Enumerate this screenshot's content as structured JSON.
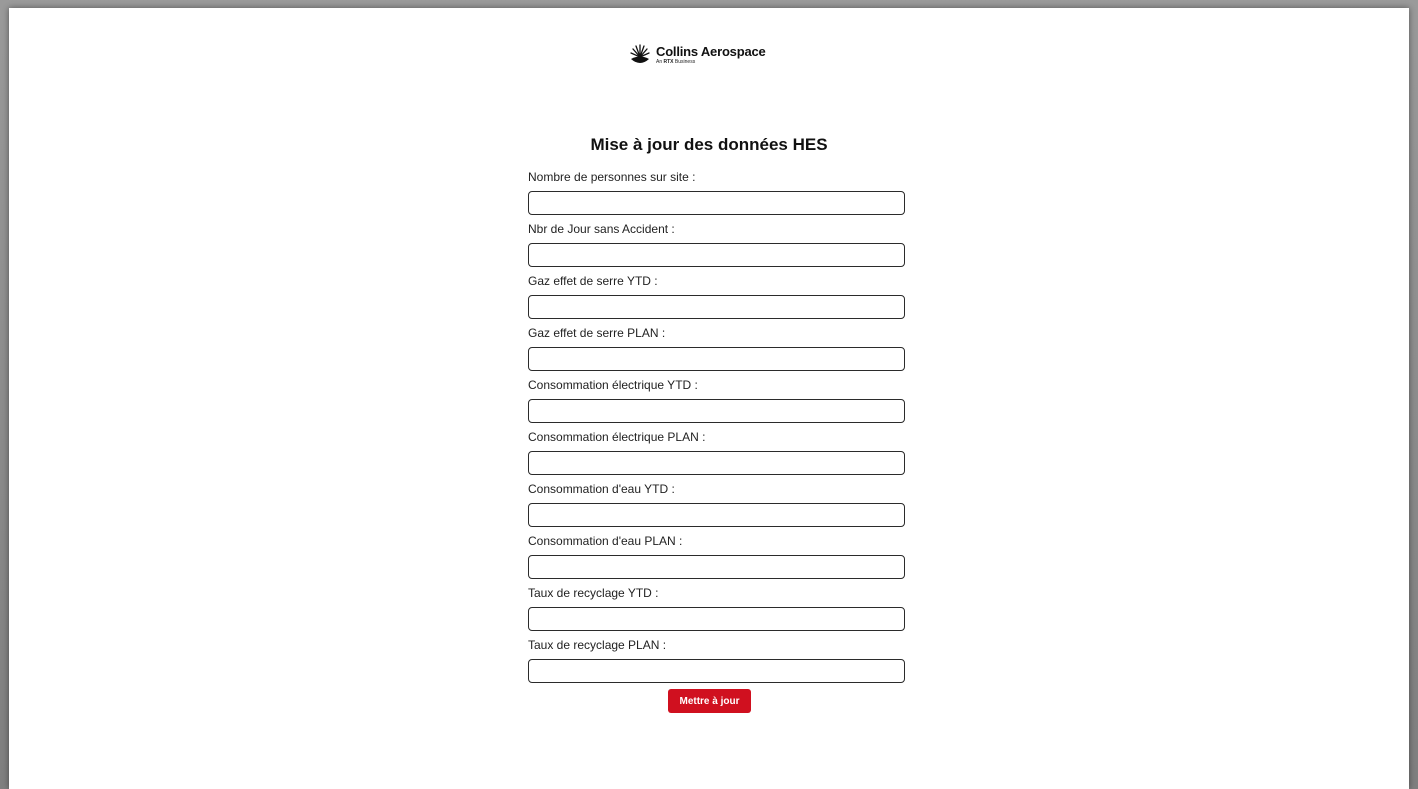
{
  "brand": {
    "name": "Collins Aerospace",
    "tagline_prefix": "An ",
    "tagline_bold": "RTX",
    "tagline_suffix": " Business",
    "accent_color": "#d0101f",
    "logo_icon": "sunburst-logo-icon"
  },
  "form": {
    "title": "Mise à jour des données HES",
    "fields": [
      {
        "label": "Nombre de personnes sur site :",
        "value": ""
      },
      {
        "label": "Nbr de Jour sans Accident :",
        "value": ""
      },
      {
        "label": "Gaz effet de serre YTD :",
        "value": ""
      },
      {
        "label": "Gaz effet de serre PLAN :",
        "value": ""
      },
      {
        "label": "Consommation électrique YTD :",
        "value": ""
      },
      {
        "label": "Consommation électrique PLAN :",
        "value": ""
      },
      {
        "label": "Consommation d'eau YTD :",
        "value": ""
      },
      {
        "label": "Consommation d'eau PLAN :",
        "value": ""
      },
      {
        "label": "Taux de recyclage YTD :",
        "value": ""
      },
      {
        "label": "Taux de recyclage PLAN :",
        "value": ""
      }
    ],
    "submit_label": "Mettre à jour"
  }
}
